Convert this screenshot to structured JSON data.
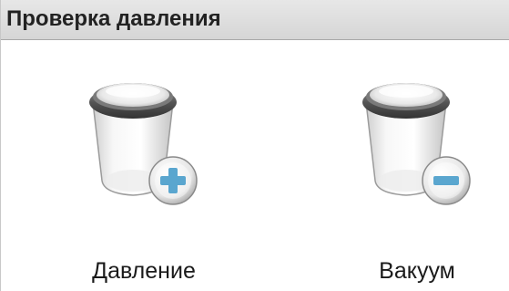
{
  "panel": {
    "title": "Проверка давления"
  },
  "actions": [
    {
      "label": "Давление",
      "icon": "cup-plus-icon",
      "badge_color": "#5aa6cf"
    },
    {
      "label": "Вакуум",
      "icon": "cup-minus-icon",
      "badge_color": "#5aa6cf"
    }
  ]
}
